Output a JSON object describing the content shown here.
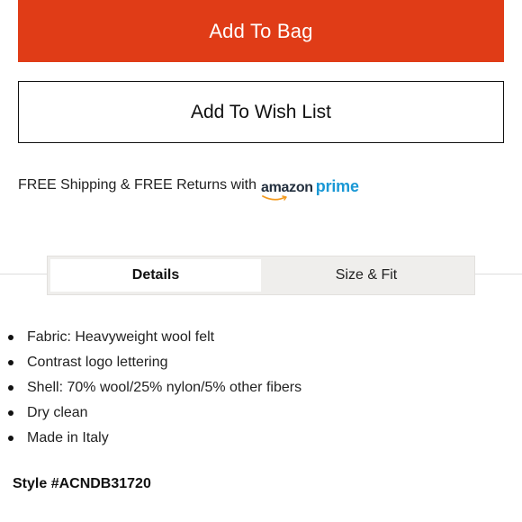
{
  "actions": {
    "add_to_bag_label": "Add To Bag",
    "add_to_wish_list_label": "Add To Wish List"
  },
  "shipping": {
    "text": "FREE Shipping & FREE Returns with",
    "logo_amazon": "amazon",
    "logo_prime": "prime"
  },
  "tabs": [
    {
      "label": "Details",
      "active": true
    },
    {
      "label": "Size & Fit",
      "active": false
    }
  ],
  "details": {
    "bullets": [
      "Fabric: Heavyweight wool felt",
      "Contrast logo lettering",
      "Shell: 70% wool/25% nylon/5% other fibers",
      "Dry clean",
      "Made in Italy"
    ],
    "style_number": "Style #ACNDB31720"
  },
  "colors": {
    "primary_button": "#e03c17",
    "prime_blue": "#1a98d5",
    "tab_background": "#efeeec"
  }
}
